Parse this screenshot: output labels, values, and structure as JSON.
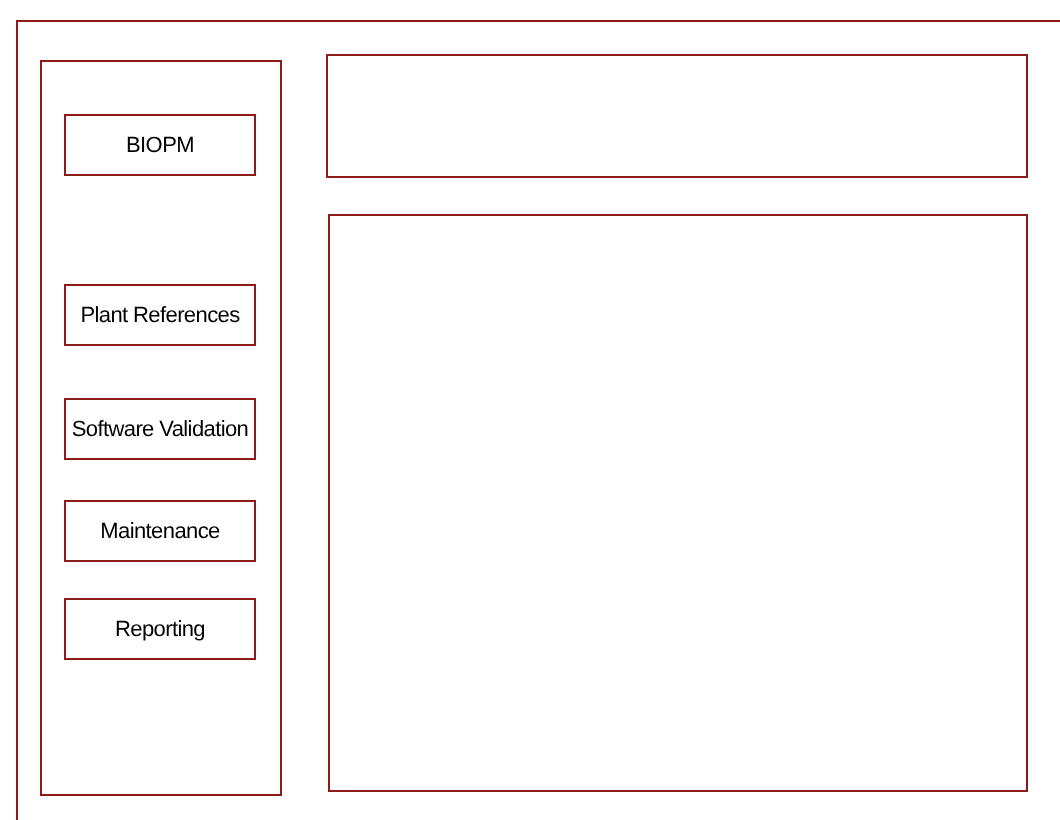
{
  "sidebar": {
    "items": [
      {
        "label": "BIOPM"
      },
      {
        "label": "Plant References"
      },
      {
        "label": "Software Validation"
      },
      {
        "label": "Maintenance"
      },
      {
        "label": "Reporting"
      }
    ]
  }
}
